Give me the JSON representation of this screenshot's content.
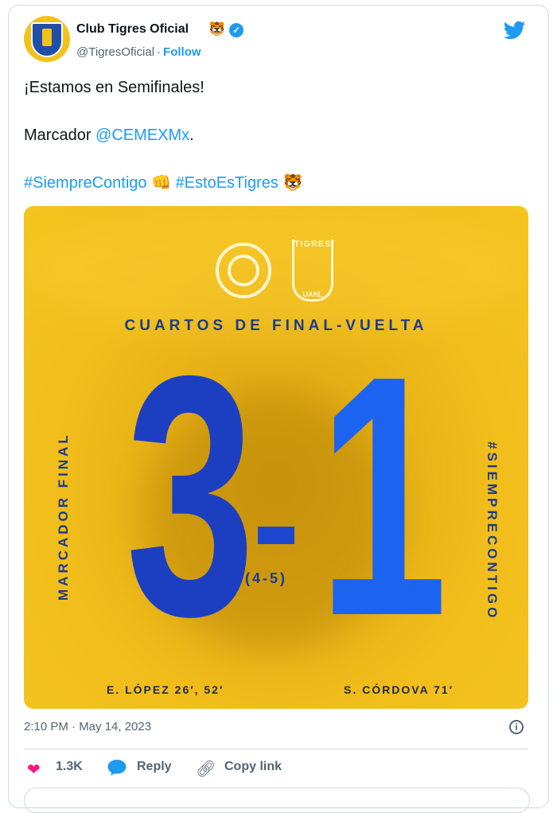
{
  "account": {
    "name": "Club Tigres Oficial",
    "name_emoji": "🐯",
    "handle": "@TigresOficial",
    "separator": "·",
    "follow_label": "Follow"
  },
  "tweet": {
    "line1": "¡Estamos en Semifinales!",
    "line2_prefix": "Marcador ",
    "line2_mention": "@CEMEXMx",
    "line2_suffix": ".",
    "hashtag1": "#SiempreContigo",
    "emoji1": "👊",
    "hashtag2": "#EstoEsTigres",
    "emoji2": "🐯"
  },
  "media": {
    "logo_label": "TIGRES",
    "logo_sub": "UANL",
    "subtitle": "CUARTOS DE FINAL-VUELTA",
    "score_home": "3",
    "score_away": "1",
    "aggregate": "(4-5)",
    "left_vertical": "MARCADOR FINAL",
    "right_vertical": "#SIEMPRECONTIGO",
    "scorer_left": "E. LÓPEZ 26′, 52′",
    "scorer_right": "S. CÓRDOVA 71′"
  },
  "meta": {
    "timestamp": "2:10 PM · May 14, 2023"
  },
  "actions": {
    "likes": "1.3K",
    "reply": "Reply",
    "copy": "Copy link"
  },
  "colors": {
    "twitter_blue": "#1d9bf0",
    "tigres_yellow": "#f2c21a",
    "score_blue": "#1c46d0",
    "like_pink": "#f91880"
  }
}
